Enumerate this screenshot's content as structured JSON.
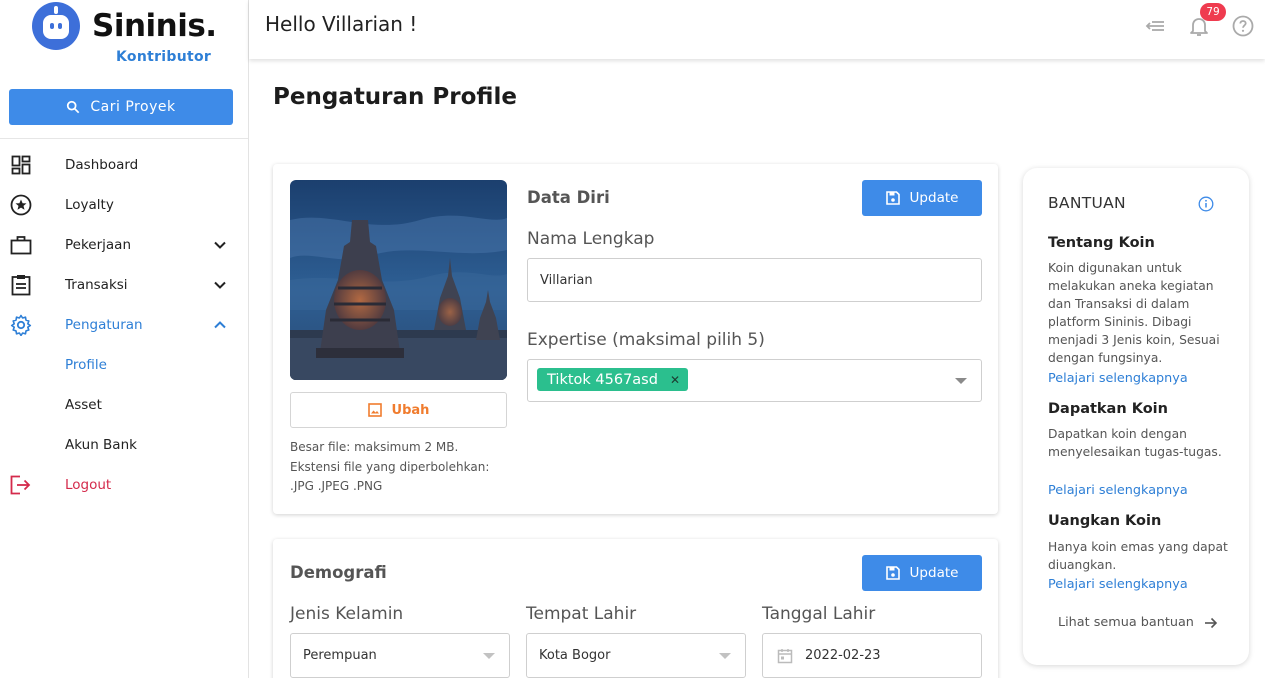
{
  "brand": {
    "name": "Sininis.",
    "subtitle": "Kontributor",
    "accent": "#3e8be8"
  },
  "sidebar": {
    "search_label": "Cari Proyek",
    "items": [
      {
        "label": "Dashboard",
        "icon": "dashboard-icon"
      },
      {
        "label": "Loyalty",
        "icon": "star-icon"
      },
      {
        "label": "Pekerjaan",
        "icon": "briefcase-icon",
        "expandable": true
      },
      {
        "label": "Transaksi",
        "icon": "clipboard-icon",
        "expandable": true
      },
      {
        "label": "Pengaturan",
        "icon": "gear-icon",
        "expandable": true,
        "expanded": true,
        "active": true
      },
      {
        "label": "Profile",
        "sub": true,
        "active": true
      },
      {
        "label": "Asset",
        "sub": true
      },
      {
        "label": "Akun Bank",
        "sub": true
      },
      {
        "label": "Logout",
        "icon": "logout-icon",
        "danger": true
      }
    ]
  },
  "topbar": {
    "greeting": "Hello Villarian !",
    "notification_count": "79"
  },
  "page": {
    "title": "Pengaturan Profile"
  },
  "data_diri": {
    "title": "Data Diri",
    "update_label": "Update",
    "photo_button": "Ubah",
    "file_info": [
      "Besar file: maksimum 2 MB.",
      "Ekstensi file yang diperbolehkan:",
      ".JPG .JPEG .PNG"
    ],
    "name_label": "Nama Lengkap",
    "name_value": "Villarian",
    "expertise_label": "Expertise (maksimal pilih 5)",
    "expertise_chips": [
      "Tiktok 4567asd"
    ]
  },
  "demografi": {
    "title": "Demografi",
    "update_label": "Update",
    "gender_label": "Jenis Kelamin",
    "gender_value": "Perempuan",
    "birthplace_label": "Tempat Lahir",
    "birthplace_value": "Kota Bogor",
    "birthdate_label": "Tanggal Lahir",
    "birthdate_value": "2022-02-23"
  },
  "help": {
    "title": "BANTUAN",
    "sections": [
      {
        "heading": "Tentang Koin",
        "body": "Koin digunakan untuk melakukan aneka kegiatan dan Transaksi di dalam platform Sininis. Dibagi menjadi 3 Jenis koin, Sesuai dengan fungsinya.",
        "link": "Pelajari selengkapnya"
      },
      {
        "heading": "Dapatkan Koin",
        "body": "Dapatkan koin dengan menyelesaikan tugas-tugas.",
        "link": "Pelajari selengkapnya"
      },
      {
        "heading": "Uangkan Koin",
        "body": "Hanya koin emas yang dapat diuangkan.",
        "link": "Pelajari selengkapnya"
      }
    ],
    "all_link": "Lihat semua bantuan"
  }
}
